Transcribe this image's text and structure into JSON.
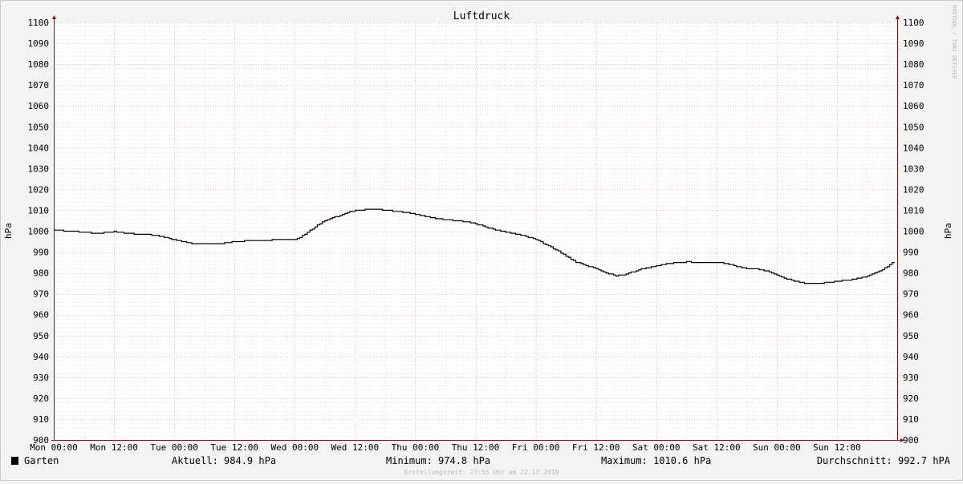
{
  "colors": {
    "background": "#f3f3f3",
    "canvas": "#ffffff",
    "grid_minor": "#cfcfcf",
    "grid_major": "#e8a8a8",
    "axis": "#7a1010",
    "line": "#000000",
    "text": "#000000",
    "watermark": "#b8b8b8"
  },
  "watermark": "RRDTOOL / TOBI OETIKER",
  "footer": {
    "legend_label": "Garten",
    "legend_icon": "square-swatch",
    "current": "Aktuell: 984.9 hPa",
    "minimum": "Minimum: 974.8 hPa",
    "maximum": "Maximum: 1010.6 hPa",
    "average": "Durchschnitt: 992.7 hPA",
    "created": "Erstellungszeit: 23:55 Uhr am 22.12.2019"
  },
  "chart_data": {
    "type": "line",
    "title": "Luftdruck",
    "ylabel": "hPa",
    "ylabel_right": "hPa",
    "ylim": [
      900,
      1100
    ],
    "yticks": [
      900,
      910,
      920,
      930,
      940,
      950,
      960,
      970,
      980,
      990,
      1000,
      1010,
      1020,
      1030,
      1040,
      1050,
      1060,
      1070,
      1080,
      1090,
      1100
    ],
    "x_unit": "hours since Mon 00:00",
    "xlim": [
      0,
      168
    ],
    "xticks": [
      {
        "h": 0,
        "label": "Mon 00:00"
      },
      {
        "h": 12,
        "label": "Mon 12:00"
      },
      {
        "h": 24,
        "label": "Tue 00:00"
      },
      {
        "h": 36,
        "label": "Tue 12:00"
      },
      {
        "h": 48,
        "label": "Wed 00:00"
      },
      {
        "h": 60,
        "label": "Wed 12:00"
      },
      {
        "h": 72,
        "label": "Thu 00:00"
      },
      {
        "h": 84,
        "label": "Thu 12:00"
      },
      {
        "h": 96,
        "label": "Fri 00:00"
      },
      {
        "h": 108,
        "label": "Fri 12:00"
      },
      {
        "h": 120,
        "label": "Sat 00:00"
      },
      {
        "h": 132,
        "label": "Sat 12:00"
      },
      {
        "h": 144,
        "label": "Sun 00:00"
      },
      {
        "h": 156,
        "label": "Sun 12:00"
      }
    ],
    "grid": true,
    "legend": "bottom-left",
    "series": [
      {
        "name": "Garten",
        "step": true,
        "x": [
          0,
          3,
          6,
          8,
          10,
          12,
          14,
          16,
          18,
          20,
          22,
          24,
          26,
          28,
          30,
          32,
          34,
          36,
          38,
          40,
          42,
          44,
          46,
          48,
          50,
          52,
          54,
          56,
          58,
          60,
          62,
          64,
          66,
          68,
          70,
          72,
          74,
          76,
          78,
          80,
          82,
          84,
          86,
          88,
          90,
          92,
          94,
          96,
          98,
          100,
          102,
          104,
          106,
          108,
          110,
          112,
          114,
          116,
          118,
          120,
          122,
          124,
          126,
          128,
          130,
          132,
          134,
          136,
          138,
          140,
          142,
          144,
          146,
          148,
          150,
          152,
          154,
          156,
          158,
          160,
          162,
          164,
          166,
          167
        ],
        "y": [
          1000.5,
          1000,
          999.5,
          999,
          999.3,
          999.8,
          999.2,
          998.7,
          998.5,
          998,
          997.2,
          995.8,
          994.8,
          994,
          993.8,
          993.8,
          994.3,
          995,
          995.3,
          995.4,
          995.6,
          995.8,
          995.8,
          995.8,
          998.5,
          1002,
          1005,
          1006.8,
          1008.5,
          1010,
          1010.3,
          1010.5,
          1010,
          1009.5,
          1009,
          1008,
          1007,
          1006,
          1005.5,
          1005,
          1004.5,
          1003.5,
          1002,
          1000.5,
          999.5,
          998.5,
          997.5,
          996,
          993.5,
          991,
          988,
          985.2,
          983.4,
          982.2,
          980,
          978.7,
          979.4,
          981.1,
          982.4,
          983.5,
          984.3,
          985,
          985.3,
          985.1,
          984.9,
          985.2,
          984.5,
          983,
          982,
          981.8,
          981,
          979,
          977.2,
          975.8,
          975,
          975,
          975.4,
          976,
          976.5,
          977.3,
          978.5,
          980.3,
          983,
          984.9
        ]
      }
    ]
  }
}
